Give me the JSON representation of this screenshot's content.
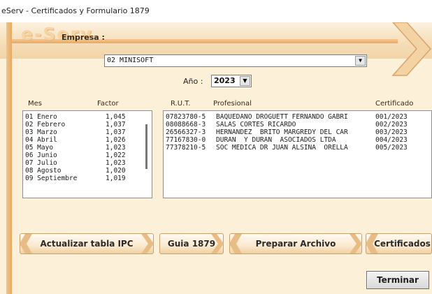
{
  "window": {
    "title": "eServ - Certificados y Formulario 1879"
  },
  "logo": {
    "text": "e-Serv"
  },
  "empresa": {
    "label": "Empresa :",
    "value": "02 MINISOFT"
  },
  "anio": {
    "label": "Año :",
    "value": "2023"
  },
  "factor_table": {
    "headers": {
      "mes": "Mes",
      "factor": "Factor"
    },
    "rows": [
      {
        "mes": "01 Enero",
        "factor": "1,045"
      },
      {
        "mes": "02 Febrero",
        "factor": "1,037"
      },
      {
        "mes": "03 Marzo",
        "factor": "1,037"
      },
      {
        "mes": "04 Abril",
        "factor": "1,026"
      },
      {
        "mes": "05 Mayo",
        "factor": "1,023"
      },
      {
        "mes": "06 Junio",
        "factor": "1,022"
      },
      {
        "mes": "07 Julio",
        "factor": "1,023"
      },
      {
        "mes": "08 Agosto",
        "factor": "1,020"
      },
      {
        "mes": "09 Septiembre",
        "factor": "1,019"
      }
    ]
  },
  "prof_table": {
    "headers": {
      "rut": "R.U.T.",
      "profesional": "Profesional",
      "certificado": "Certificado"
    },
    "rows": [
      {
        "rut": "07823780-5",
        "profesional": "BAQUEDANO DROGUETT FERNANDO GABRI",
        "certificado": "001/2023"
      },
      {
        "rut": "08088668-3",
        "profesional": "SALAS CORTES RICARDO",
        "certificado": "002/2023"
      },
      {
        "rut": "26566327-3",
        "profesional": "HERNANDEZ  BRITO MARGREDY DEL CAR",
        "certificado": "003/2023"
      },
      {
        "rut": "77167830-0",
        "profesional": "DURAN  Y DURAN  ASOCIADOS LTDA",
        "certificado": "004/2023"
      },
      {
        "rut": "77378210-5",
        "profesional": "SOC MEDICA DR JUAN ALSINA  ORELLA",
        "certificado": "005/2023"
      }
    ]
  },
  "buttons": {
    "actualizar": "Actualizar tabla IPC",
    "guia": "Guia 1879",
    "preparar": "Preparar Archivo",
    "certificados": "Certificados",
    "terminar": "Terminar"
  }
}
